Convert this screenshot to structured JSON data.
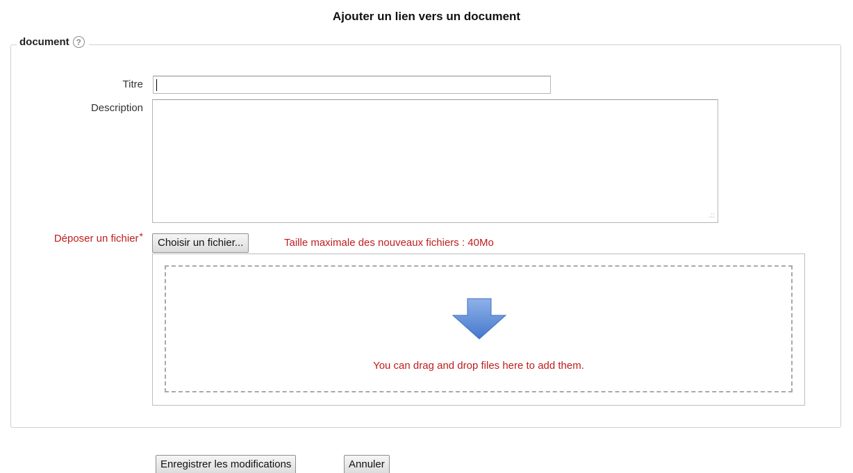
{
  "page_title": "Ajouter un lien vers un document",
  "section": {
    "legend": "document",
    "help_icon": "?"
  },
  "fields": {
    "title_label": "Titre",
    "title_value": "",
    "description_label": "Description",
    "description_value": "",
    "file_label": "Déposer un fichier",
    "required_marker": "*",
    "choose_file_label": "Choisir un fichier...",
    "max_size_text": "Taille maximale des nouveaux fichiers : 40Mo",
    "dropzone_text": "You can drag and drop files here to add them.",
    "dropzone_icon": "drop-arrow-icon",
    "resize_grip_icon": "resize-grip-icon"
  },
  "actions": {
    "save_label": "Enregistrer les modifications",
    "cancel_label": "Annuler"
  },
  "colors": {
    "required": "#bf1c1c",
    "arrow": "#5b8bd6",
    "dashed_border": "#a8a8a8"
  }
}
